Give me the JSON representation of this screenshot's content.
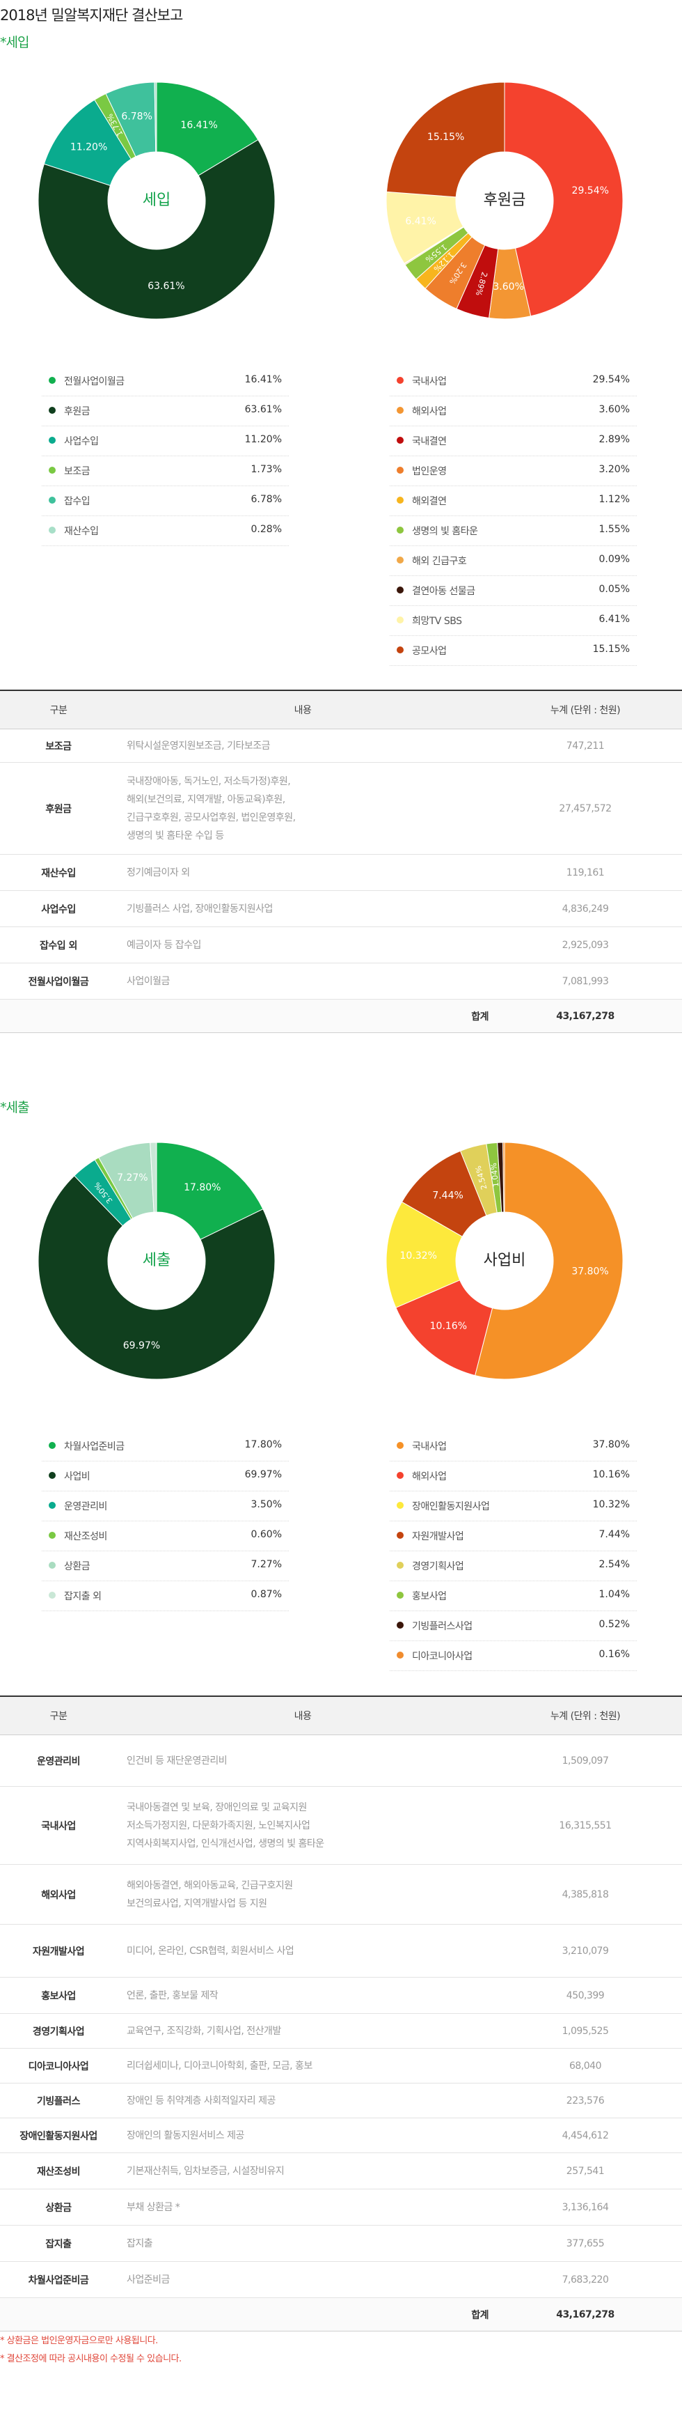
{
  "title": "2018년 밀알복지재단 결산보고",
  "income_section": "*세입",
  "expense_section": "*세출",
  "chart_data": [
    {
      "type": "pie",
      "center_label": "세입",
      "categories": [
        "전월사업이월금",
        "후원금",
        "사업수입",
        "보조금",
        "잡수입",
        "재산수입"
      ],
      "values": [
        16.41,
        63.61,
        11.2,
        1.73,
        6.78,
        0.28
      ],
      "value_labels": [
        "16.41%",
        "63.61%",
        "11.20%",
        "1.73%",
        "6.78%",
        "0.28%"
      ],
      "slice_labels": [
        "16.41%",
        "63.61%",
        "11.20%",
        "1.73%",
        "6.78%",
        ""
      ],
      "colors": [
        "#11b04f",
        "#103f1e",
        "#0aab8e",
        "#7ac943",
        "#3fc19c",
        "#a8dfc8"
      ]
    },
    {
      "type": "pie",
      "center_label": "후원금",
      "categories": [
        "국내사업",
        "해외사업",
        "국내결연",
        "법인운영",
        "해외결연",
        "생명의 빛 홈타운",
        "해외 긴급구호",
        "결연아동 선물금",
        "희망TV SBS",
        "공모사업"
      ],
      "values": [
        29.54,
        3.6,
        2.89,
        3.2,
        1.12,
        1.55,
        0.09,
        0.05,
        6.41,
        15.15
      ],
      "value_labels": [
        "29.54%",
        "3.60%",
        "2.89%",
        "3.20%",
        "1.12%",
        "1.55%",
        "0.09%",
        "0.05%",
        "6.41%",
        "15.15%"
      ],
      "slice_labels": [
        "29.54%",
        "3.60%",
        "2.89%",
        "3.20%",
        "1.12%",
        "1.55%",
        "",
        "",
        "6.41%",
        "15.15%"
      ],
      "colors": [
        "#f4422e",
        "#f39633",
        "#c00d0d",
        "#ee7e2c",
        "#f7b51e",
        "#8ec63f",
        "#f0a848",
        "#3a160a",
        "#fff3a8",
        "#c4440f"
      ]
    },
    {
      "type": "pie",
      "center_label": "세출",
      "categories": [
        "차월사업준비금",
        "사업비",
        "운영관리비",
        "재산조성비",
        "상환금",
        "잡지출 외"
      ],
      "values": [
        17.8,
        69.97,
        3.5,
        0.6,
        7.27,
        0.87
      ],
      "value_labels": [
        "17.80%",
        "69.97%",
        "3.50%",
        "0.60%",
        "7.27%",
        "0.87%"
      ],
      "slice_labels": [
        "17.80%",
        "69.97%",
        "3.50%",
        "",
        "7.27%",
        ""
      ],
      "colors": [
        "#11b04f",
        "#103f1e",
        "#0aab8e",
        "#7ac943",
        "#a9dcc0",
        "#c9e7d6"
      ]
    },
    {
      "type": "pie",
      "center_label": "사업비",
      "categories": [
        "국내사업",
        "해외사업",
        "장애인활동지원사업",
        "자원개발사업",
        "경영기획사업",
        "홍보사업",
        "기빙플러스사업",
        "디아코니아사업"
      ],
      "values": [
        37.8,
        10.16,
        10.32,
        7.44,
        2.54,
        1.04,
        0.52,
        0.16
      ],
      "value_labels": [
        "37.80%",
        "10.16%",
        "10.32%",
        "7.44%",
        "2.54%",
        "1.04%",
        "0.52%",
        "0.16%"
      ],
      "slice_labels": [
        "37.80%",
        "10.16%",
        "10.32%",
        "7.44%",
        "2.54%",
        "1.04%",
        "",
        ""
      ],
      "colors": [
        "#f59127",
        "#f4422e",
        "#fde93c",
        "#c4440f",
        "#e0d05a",
        "#8ec63f",
        "#3a160a",
        "#f08c2e"
      ]
    }
  ],
  "income_table": {
    "headers": [
      "구분",
      "내용",
      "누계 (단위 : 천원)"
    ],
    "rows": [
      {
        "cat": "보조금",
        "desc": "위탁시설운영지원보조금, 기타보조금",
        "amt": "747,211"
      },
      {
        "cat": "후원금",
        "desc": "국내장애아동, 독거노인, 저소득가정)후원,\n해외(보건의료, 지역개발, 아동교육)후원,\n긴급구호후원, 공모사업후원, 법인운영후원,\n생명의 빛 홈타운 수입 등",
        "amt": "27,457,572"
      },
      {
        "cat": "재산수입",
        "desc": "정기예금이자 외",
        "amt": "119,161"
      },
      {
        "cat": "사업수입",
        "desc": "기빙플러스 사업, 장애인활동지원사업",
        "amt": "4,836,249"
      },
      {
        "cat": "잡수입 외",
        "desc": "예금이자 등 잡수입",
        "amt": "2,925,093"
      },
      {
        "cat": "전월사업이월금",
        "desc": "사업이월금",
        "amt": "7,081,993"
      }
    ],
    "total_label": "합계",
    "total_amt": "43,167,278"
  },
  "expense_table": {
    "headers": [
      "구분",
      "내용",
      "누계 (단위 : 천원)"
    ],
    "rows": [
      {
        "cat": "운영관리비",
        "desc": "인건비 등 재단운영관리비",
        "amt": "1,509,097"
      },
      {
        "cat": "국내사업",
        "desc": "국내아동결연 및 보육, 장애인의료 및 교육지원\n저소득가정지원, 다문화가족지원, 노인복지사업\n지역사회복지사업, 인식개선사업, 생명의 빛 홈타운",
        "amt": "16,315,551"
      },
      {
        "cat": "해외사업",
        "desc": "해외아동결연, 해외아동교육, 긴급구호지원\n보건의료사업, 지역개발사업 등 지원",
        "amt": "4,385,818"
      },
      {
        "cat": "자원개발사업",
        "desc": "미디어, 온라인, CSR협력, 회원서비스 사업",
        "amt": "3,210,079"
      },
      {
        "cat": "홍보사업",
        "desc": "언론, 출판, 홍보물 제작",
        "amt": "450,399"
      },
      {
        "cat": "경영기획사업",
        "desc": "교육연구, 조직강화, 기획사업, 전산개발",
        "amt": "1,095,525"
      },
      {
        "cat": "디아코니아사업",
        "desc": "리더쉽세미나, 디아코니아학회, 출판, 모금, 홍보",
        "amt": "68,040"
      },
      {
        "cat": "기빙플러스",
        "desc": "장애인 등 취약계층 사회적일자리 제공",
        "amt": "223,576"
      },
      {
        "cat": "장애인활동지원사업",
        "desc": "장애인의 활동지원서비스 제공",
        "amt": "4,454,612"
      },
      {
        "cat": "재산조성비",
        "desc": "기본재산취득, 임차보증금, 시설장비유지",
        "amt": "257,541"
      },
      {
        "cat": "상환금",
        "desc": "부채 상환금 *",
        "amt": "3,136,164"
      },
      {
        "cat": "잡지출",
        "desc": "잡지출",
        "amt": "377,655"
      },
      {
        "cat": "차월사업준비금",
        "desc": "사업준비금",
        "amt": "7,683,220"
      }
    ],
    "total_label": "합계",
    "total_amt": "43,167,278"
  },
  "notes": [
    "* 상환금은 법인운영자금으로만 사용됩니다.",
    "* 결산조정에 따라 공시내용이 수정될 수 있습니다."
  ]
}
